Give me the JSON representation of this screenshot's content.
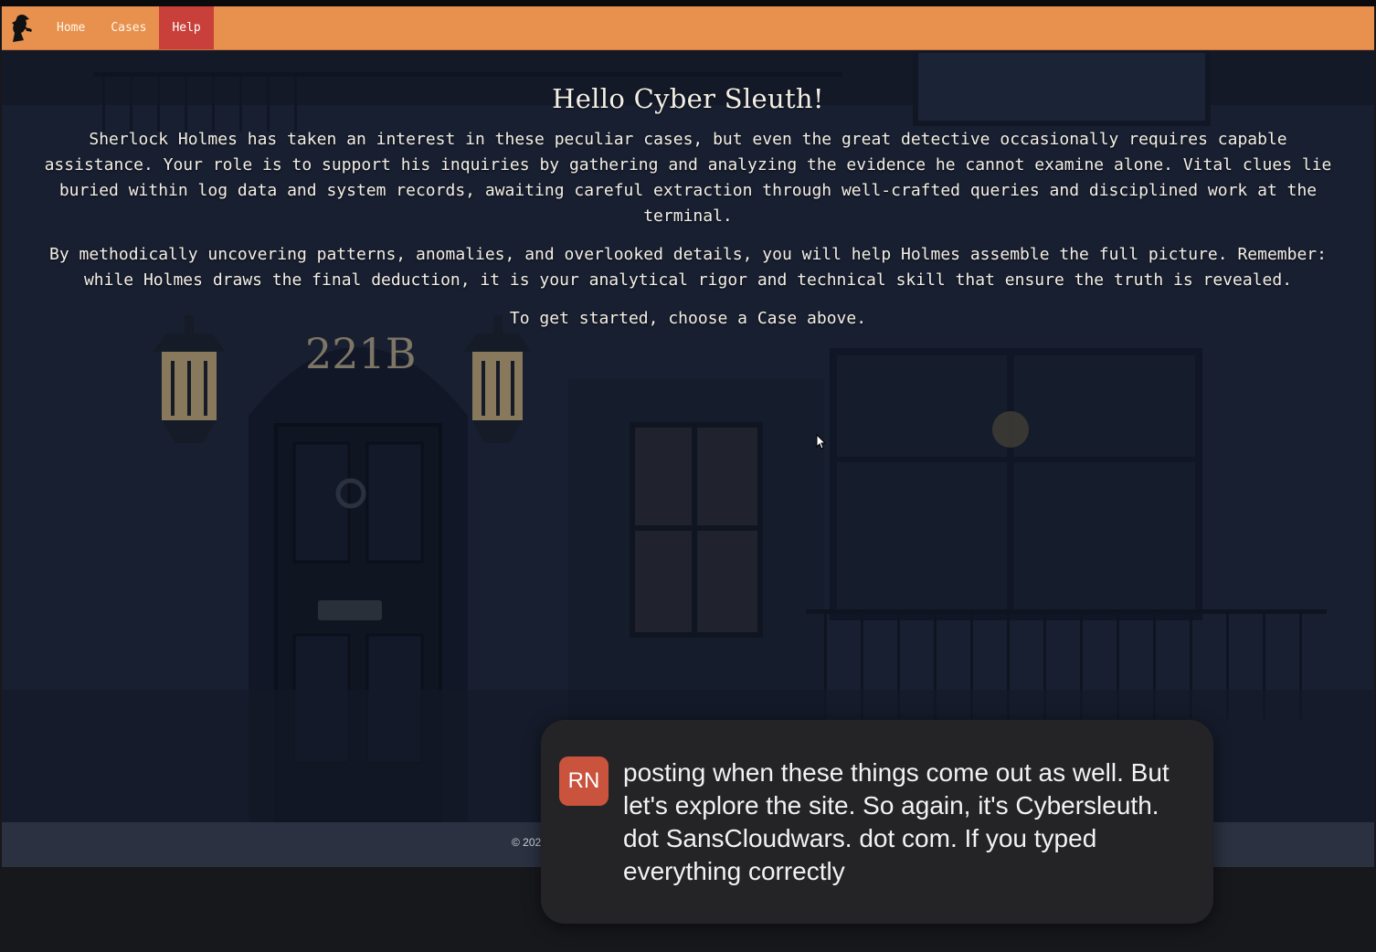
{
  "nav": {
    "logo_icon": "detective-silhouette-icon",
    "items": [
      {
        "label": "Home",
        "active": false
      },
      {
        "label": "Cases",
        "active": false
      },
      {
        "label": "Help",
        "active": true
      }
    ]
  },
  "hero": {
    "title": "Hello Cyber Sleuth!",
    "paragraphs": [
      "Sherlock Holmes has taken an interest in these peculiar cases, but even the great detective occasionally requires capable assistance. Your role is to support his inquiries by gathering and analyzing the evidence he cannot examine alone. Vital clues lie buried within log data and system records, awaiting careful extraction through well-crafted queries and disciplined work at the terminal.",
      "By methodically uncovering patterns, anomalies, and overlooked details, you will help Holmes assemble the full picture. Remember: while Holmes draws the final deduction, it is your analytical rigor and technical skill that ensure the truth is revealed.",
      "To get started, choose a Case above."
    ],
    "door_number": "221B"
  },
  "footer": {
    "text": "© 202"
  },
  "caption": {
    "avatar_initials": "RN",
    "text": "posting when these things come out as well. But let's explore the site. So again, it's Cybersleuth. dot SansCloudwars. dot com. If you typed everything correctly"
  },
  "colors": {
    "navbar": "#e8914e",
    "nav_active": "#c9403a",
    "footer": "#2b3141",
    "caption_bg": "#242426",
    "avatar_bg": "#c9533d"
  }
}
